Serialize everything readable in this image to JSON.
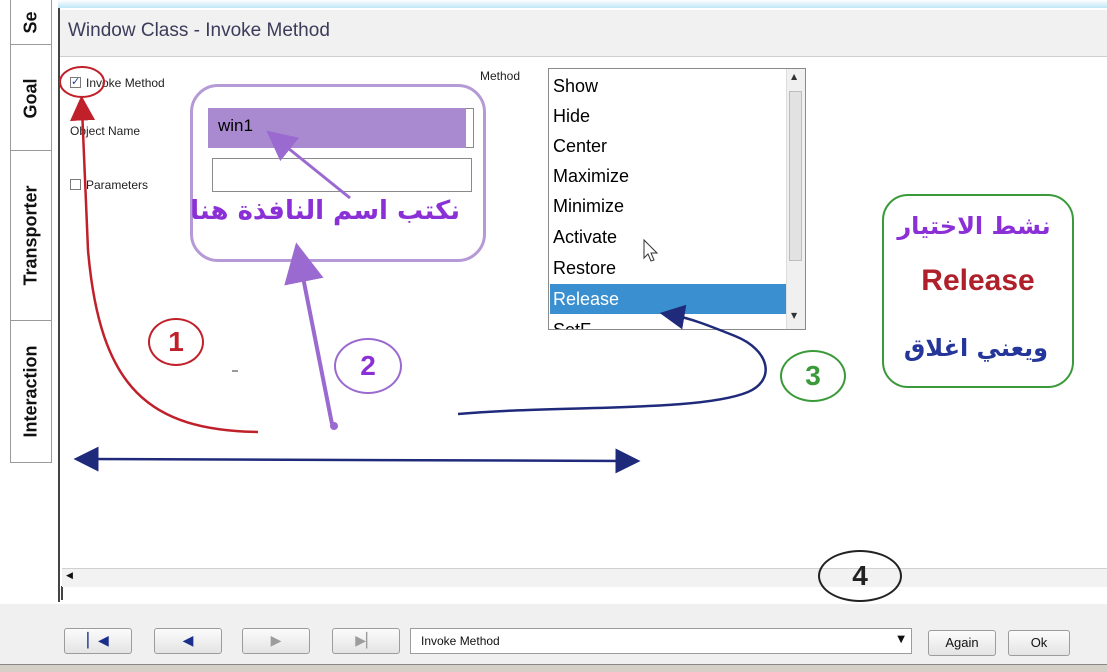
{
  "side_tabs": [
    "Se",
    "Goal",
    "Transporter",
    "Interaction"
  ],
  "window": {
    "title": "Window Class - Invoke Method"
  },
  "form": {
    "invoke_method_label": "Invoke Method",
    "invoke_method_checked": true,
    "object_name_label": "Object Name",
    "object_name_value": "win1",
    "parameters_label": "Parameters",
    "parameters_checked": false,
    "parameters_value": "",
    "method_label": "Method"
  },
  "method_list": {
    "items": [
      "Show",
      "Hide",
      "Center",
      "Maximize",
      "Minimize",
      "Activate",
      "Restore",
      "Release",
      "SetF..."
    ],
    "selected": "Release"
  },
  "annotations": {
    "arabic_write_name": "نكتب اسم النافذة هنا",
    "arabic_activate": "نشط الاختيار",
    "release_word": "Release",
    "arabic_close": "ويعني اغلاق",
    "step1": "1",
    "step2": "2",
    "step3": "3",
    "step4": "4"
  },
  "bottom": {
    "combo_value": "Invoke Method",
    "again_label": "Again",
    "ok_label": "Ok"
  },
  "colors": {
    "selection": "#3a8fd1",
    "annotation_purple": "#8b2fd6",
    "annotation_red": "#c0202a",
    "annotation_green": "#3a9a3a",
    "annotation_navy": "#1f2a7a"
  }
}
